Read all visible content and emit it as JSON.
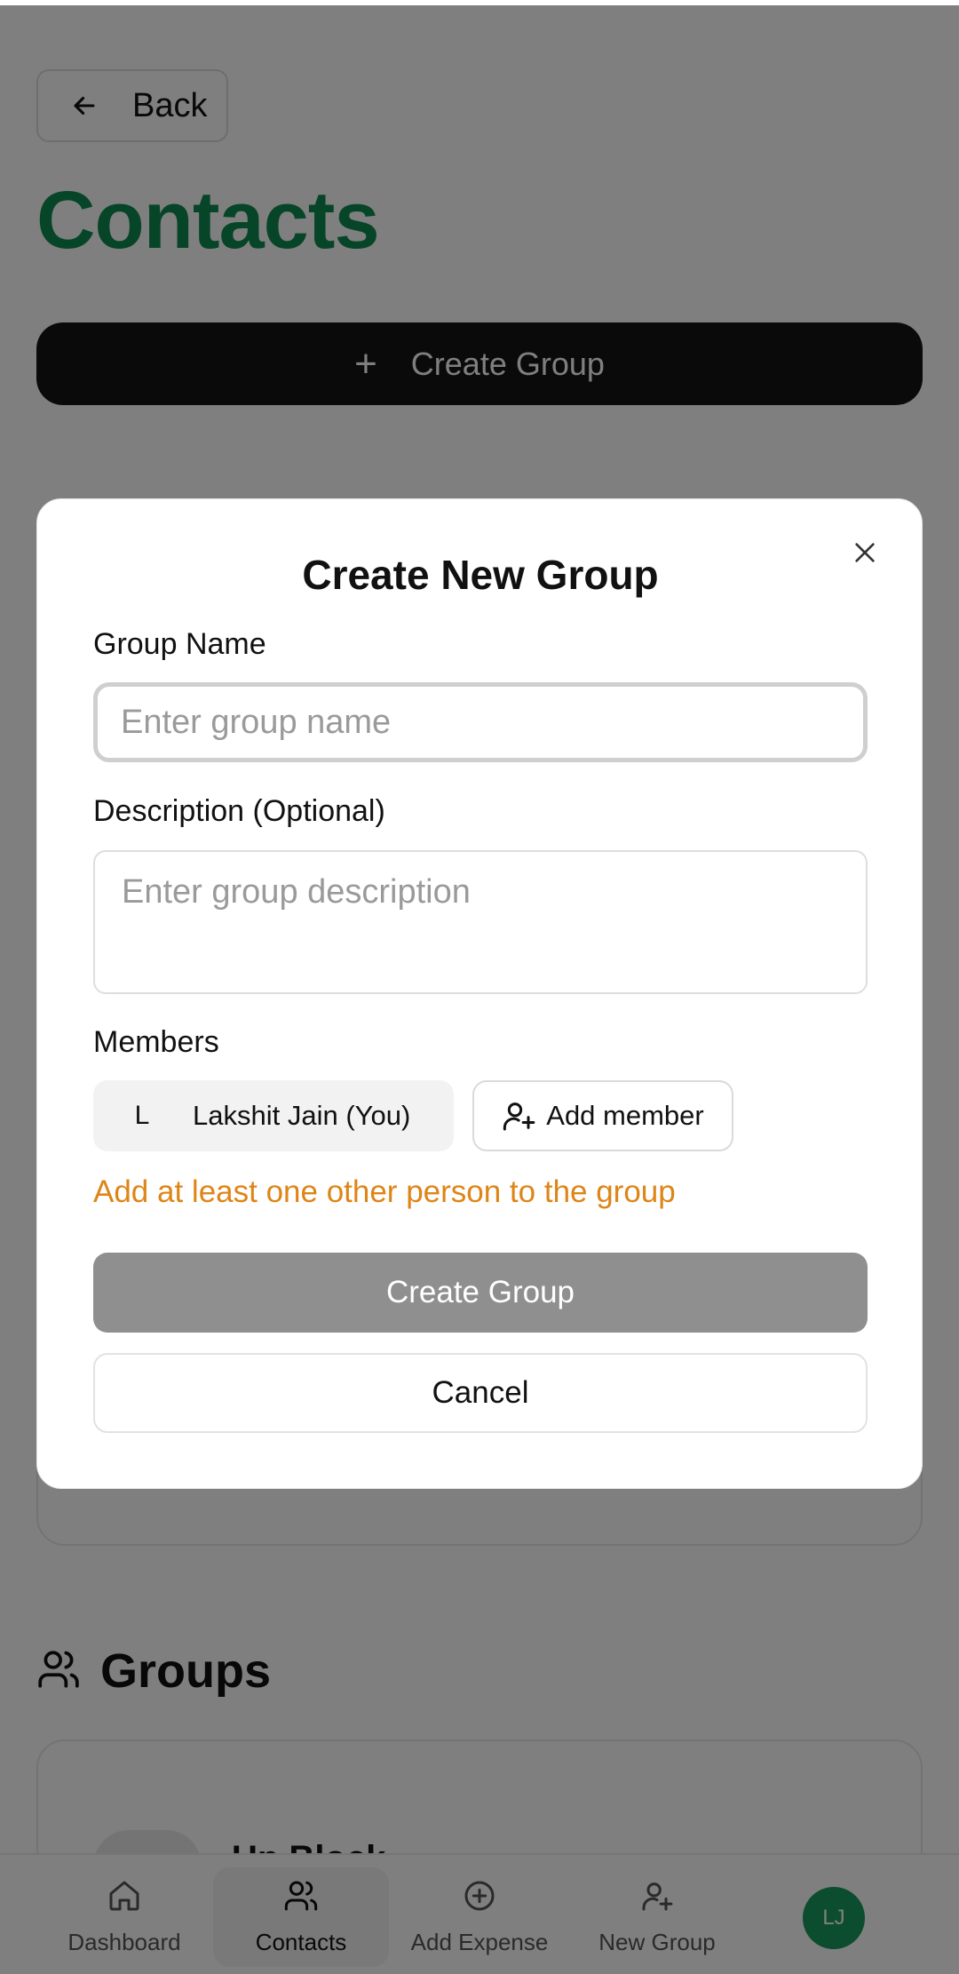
{
  "header": {
    "back_label": "Back",
    "title": "Contacts",
    "create_group_label": "Create Group"
  },
  "groups_section": {
    "title": "Groups",
    "first_group_name": "Up Block"
  },
  "bottom_nav": {
    "items": [
      {
        "label": "Dashboard",
        "icon": "home-icon"
      },
      {
        "label": "Contacts",
        "icon": "users-icon",
        "active": true
      },
      {
        "label": "Add Expense",
        "icon": "plus-circle-icon"
      },
      {
        "label": "New Group",
        "icon": "user-plus-icon"
      }
    ],
    "avatar_initials": "LJ"
  },
  "modal": {
    "title": "Create New Group",
    "group_name_label": "Group Name",
    "group_name_placeholder": "Enter group name",
    "description_label": "Description (Optional)",
    "description_placeholder": "Enter group description",
    "members_label": "Members",
    "members": [
      {
        "initial": "L",
        "name": "Lakshit Jain (You)"
      }
    ],
    "add_member_label": "Add member",
    "warning": "Add at least one other person to the group",
    "create_label": "Create Group",
    "cancel_label": "Cancel"
  },
  "colors": {
    "brand_green": "#0f8a53",
    "warning_orange": "#de8517",
    "avatar_green": "#169a5c",
    "disabled_button": "#8f8f8f"
  }
}
